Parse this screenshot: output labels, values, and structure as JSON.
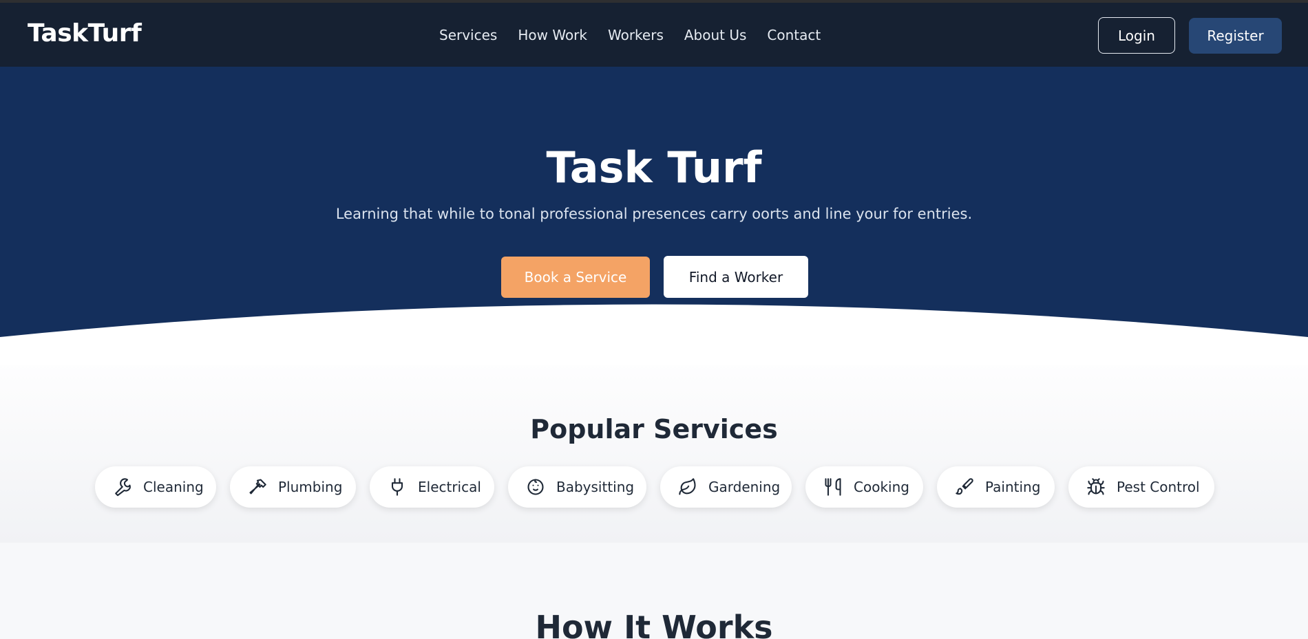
{
  "brand": {
    "logo_text": "TaskTurf"
  },
  "nav": {
    "links": [
      "Services",
      "How Work",
      "Workers",
      "About Us",
      "Contact"
    ],
    "login_label": "Login",
    "register_label": "Register"
  },
  "hero": {
    "title": "Task Turf",
    "subtitle": "Learning that while to tonal professional presences carry oorts and line your for entries.",
    "primary_cta": "Book a Service",
    "secondary_cta": "Find a Worker"
  },
  "services": {
    "title": "Popular Services",
    "items": [
      {
        "label": "Cleaning",
        "icon": "wrench-icon"
      },
      {
        "label": "Plumbing",
        "icon": "hammer-icon"
      },
      {
        "label": "Electrical",
        "icon": "plug-icon"
      },
      {
        "label": "Babysitting",
        "icon": "baby-icon"
      },
      {
        "label": "Gardening",
        "icon": "leaf-icon"
      },
      {
        "label": "Cooking",
        "icon": "utensils-icon"
      },
      {
        "label": "Painting",
        "icon": "paintbrush-icon"
      },
      {
        "label": "Pest Control",
        "icon": "bug-icon"
      }
    ]
  },
  "how_it_works": {
    "title": "How It Works"
  },
  "colors": {
    "navbar": "#162132",
    "hero": "#142f5c",
    "accent_orange": "#f4a365",
    "register_blue": "#274775"
  }
}
